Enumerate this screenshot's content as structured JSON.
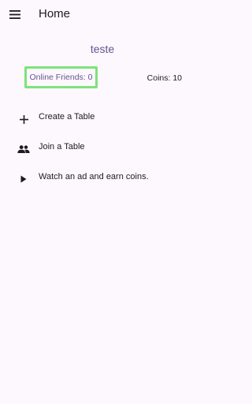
{
  "app_bar": {
    "title": "Home",
    "menu_icon": "hamburger-menu-icon"
  },
  "profile": {
    "username": "teste",
    "online_friends": "Online Friends: 0",
    "coins": "Coins: 10"
  },
  "menu": {
    "items": [
      {
        "label": "Create a Table",
        "icon": "plus-icon"
      },
      {
        "label": "Join a Table",
        "icon": "people-icon"
      },
      {
        "label": "Watch an ad and earn coins.",
        "icon": "play-icon"
      }
    ]
  },
  "colors": {
    "background": "#fdf7fe",
    "accent": "#65558f",
    "highlight_border": "#7de37a",
    "text": "#1d1b20"
  }
}
